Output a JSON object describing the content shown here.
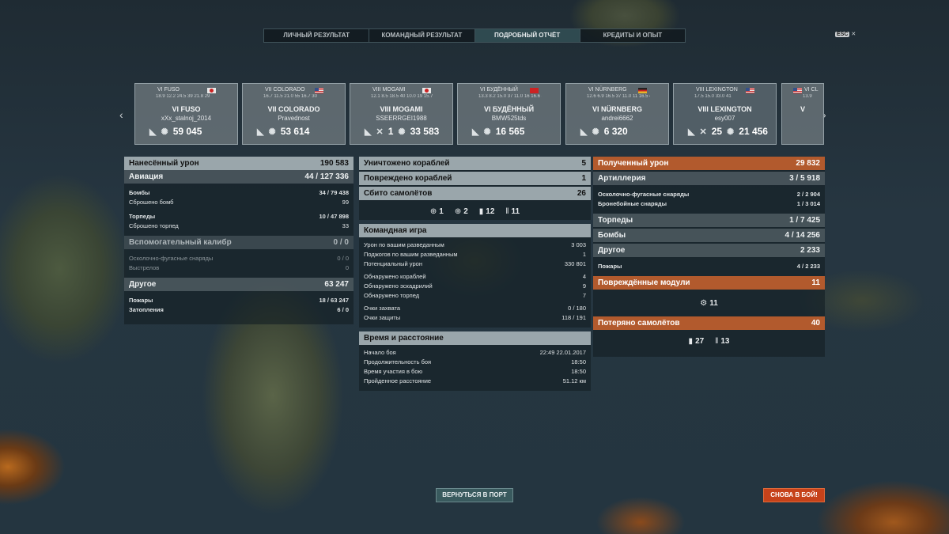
{
  "tabs": [
    {
      "label": "ЛИЧНЫЙ РЕЗУЛЬТАТ"
    },
    {
      "label": "КОМАНДНЫЙ РЕЗУЛЬТАТ"
    },
    {
      "label": "ПОДРОБНЫЙ ОТЧЁТ",
      "active": true
    },
    {
      "label": "КРЕДИТЫ И ОПЫТ"
    }
  ],
  "esc": {
    "key": "ESC",
    "close": "✕"
  },
  "ships": [
    {
      "tl": "VI FUSO",
      "mini": "18.9 12.2 24.5 39  21.8 29",
      "name": "VI FUSO",
      "player": "xXx_stalnoj_2014",
      "kills": "",
      "damage": "59 045",
      "flag": "jp"
    },
    {
      "tl": "VII COLORADO",
      "mini": "16.7 11.5 21.0 55  16.7 30",
      "name": "VII COLORADO",
      "player": "Pravednost",
      "kills": "",
      "damage": "53 614",
      "flag": "us"
    },
    {
      "tl": "VIII MOGAMI",
      "mini": "12.1 8.5 18.5 40  10.0 19 15.7 15",
      "name": "VIII MOGAMI",
      "player": "SSEERRGEI1988",
      "kills": "1",
      "damage": "33 583",
      "flag": "jp"
    },
    {
      "tl": "VI БУДЁННЫЙ",
      "mini": "13.3 8.2 15.0 37  11.0 16 16.6 8",
      "name": "VI БУДЁННЫЙ",
      "player": "BMW525tds",
      "kills": "",
      "damage": "16 565",
      "flag": "su"
    },
    {
      "tl": "VI NÜRNBERG",
      "mini": "12.6 6.9 16.5 37  11.0 11 16.5 4",
      "name": "VI NÜRNBERG",
      "player": "andrei6662",
      "kills": "",
      "damage": "6 320",
      "flag": "de"
    },
    {
      "tl": "VIII LEXINGTON",
      "mini": "17.5 15.0 33.0 41",
      "name": "VIII LEXINGTON",
      "player": "esy007",
      "kills": "25",
      "damage": "21 456",
      "flag": "us"
    },
    {
      "tl": "VI CL",
      "mini": "13.9",
      "name": "V",
      "player": "",
      "kills": "",
      "damage": "",
      "flag": "us"
    }
  ],
  "left": {
    "dealt_label": "Нанесённый урон",
    "dealt_value": "190 583",
    "aviation_label": "Авиация",
    "aviation_value": "44 / 127 336",
    "bombs_label": "Бомбы",
    "bombs_value": "34 / 79 438",
    "bombs_dropped_label": "Сброшено бомб",
    "bombs_dropped_value": "99",
    "torps_label": "Торпеды",
    "torps_value": "10 / 47 898",
    "torps_dropped_label": "Сброшено торпед",
    "torps_dropped_value": "33",
    "secondary_label": "Вспомогательный калибр",
    "secondary_value": "0 / 0",
    "he_label": "Осколочно-фугасные снаряды",
    "he_value": "0 / 0",
    "shots_label": "Выстрелов",
    "shots_value": "0",
    "other_label": "Другое",
    "other_value": "63 247",
    "fires_label": "Пожары",
    "fires_value": "18 / 63 247",
    "flood_label": "Затопления",
    "flood_value": "6 / 0"
  },
  "center": {
    "destroyed_label": "Уничтожено кораблей",
    "destroyed_value": "5",
    "damaged_label": "Повреждено кораблей",
    "damaged_value": "1",
    "planes_label": "Сбито самолётов",
    "planes_value": "26",
    "planes_icons": [
      "1",
      "2",
      "12",
      "11"
    ],
    "team_label": "Командная игра",
    "team_rows": [
      {
        "label": "Урон по вашим разведанным",
        "value": "3 003"
      },
      {
        "label": "Поджогов по вашим разведанным",
        "value": "1"
      },
      {
        "label": "Потенциальный урон",
        "value": "330 801"
      },
      {
        "label": "Обнаружено кораблей",
        "value": "4"
      },
      {
        "label": "Обнаружено эскадрилий",
        "value": "9"
      },
      {
        "label": "Обнаружено торпед",
        "value": "7"
      },
      {
        "label": "Очки захвата",
        "value": "0 / 180"
      },
      {
        "label": "Очки защиты",
        "value": "118 / 191"
      }
    ],
    "time_label": "Время и расстояние",
    "time_rows": [
      {
        "label": "Начало боя",
        "value": "22:49  22.01.2017"
      },
      {
        "label": "Продолжительность боя",
        "value": "18:50"
      },
      {
        "label": "Время участия в бою",
        "value": "18:50"
      },
      {
        "label": "Пройденное расстояние",
        "value": "51.12 км"
      }
    ]
  },
  "right": {
    "received_label": "Полученный урон",
    "received_value": "29 832",
    "artillery_label": "Артиллерия",
    "artillery_value": "3 / 5 918",
    "he_label": "Осколочно-фугасные снаряды",
    "he_value": "2 / 2 904",
    "ap_label": "Бронебойные снаряды",
    "ap_value": "1 / 3 014",
    "torps_label": "Торпеды",
    "torps_value": "1 / 7 425",
    "bombs_label": "Бомбы",
    "bombs_value": "4 / 14 256",
    "other_label": "Другое",
    "other_value": "2 233",
    "fires_label": "Пожары",
    "fires_value": "4 / 2 233",
    "modules_label": "Повреждённые модули",
    "modules_value": "11",
    "modules_icon_count": "11",
    "lost_label": "Потеряно самолётов",
    "lost_value": "40",
    "lost_icons": [
      "27",
      "13"
    ]
  },
  "buttons": {
    "port": "ВЕРНУТЬСЯ В ПОРТ",
    "battle": "СНОВА В БОЙ!"
  },
  "colors": {
    "accent_orange": "#b25a2d",
    "button_battle": "#c6421a",
    "button_port": "#395a5e"
  }
}
